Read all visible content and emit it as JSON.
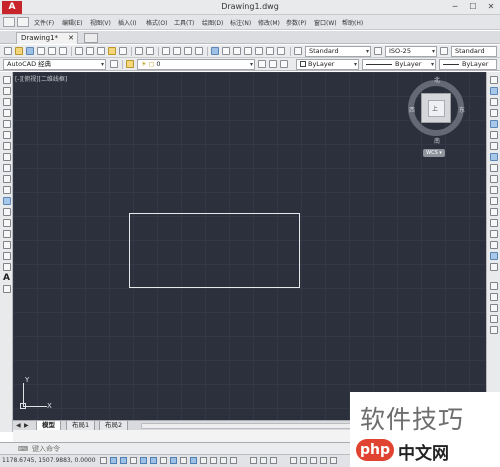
{
  "app": {
    "logo_text": "A",
    "window_title": "Drawing1.dwg",
    "window_buttons": [
      "─",
      "☐",
      "✕"
    ]
  },
  "menubar": {
    "items": [
      "文件(F)",
      "编辑(E)",
      "视图(V)",
      "插入(I)",
      "格式(O)",
      "工具(T)",
      "绘图(D)",
      "标注(N)",
      "修改(M)",
      "参数(P)",
      "窗口(W)",
      "帮助(H)"
    ]
  },
  "document_tabs": {
    "active_tab": "Drawing1*",
    "close_glyph": "✕"
  },
  "toolbar1": {
    "text_style": "Standard",
    "dim_style": "ISO-25",
    "table_style": "Standard"
  },
  "toolbar2": {
    "workspace": "AutoCAD 经典",
    "layer": "0",
    "color": "ByLayer",
    "linetype": "ByLayer",
    "lineweight": "ByLayer"
  },
  "canvas": {
    "viewport_label": "[-][俯视][二维线框]",
    "background_color": "#2b303c",
    "viewcube": {
      "north": "北",
      "south": "南",
      "east": "东",
      "west": "西",
      "face": "上",
      "wcs": "WCS ▾"
    },
    "ucs": {
      "x": "X",
      "y": "Y"
    }
  },
  "layout_tabs": {
    "nav": [
      "◀",
      "▶"
    ],
    "tabs": [
      "模型",
      "布局1",
      "布局2"
    ]
  },
  "command": {
    "placeholder": "键入命令",
    "prefix_icon": "⌨"
  },
  "status": {
    "coordinates": "1178.6745, 1507.9883, 0.0000"
  },
  "watermark": {
    "text": "软件技巧",
    "logo": "php",
    "site": "中文网"
  }
}
